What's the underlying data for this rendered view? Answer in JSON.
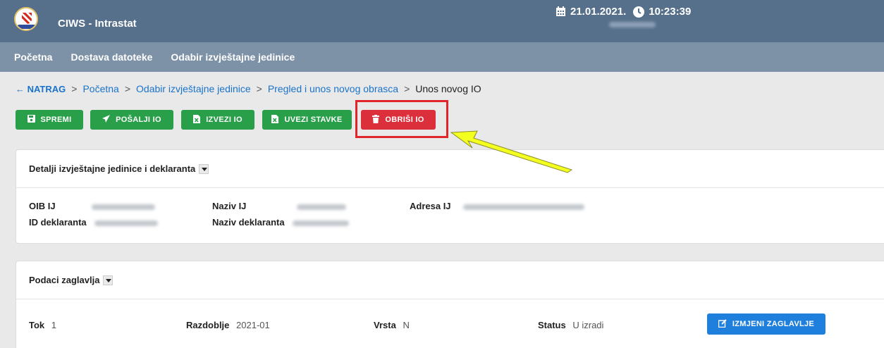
{
  "header": {
    "app_title": "CIWS - Intrastat",
    "date": "21.01.2021.",
    "time": "10:23:39"
  },
  "nav": {
    "items": [
      "Početna",
      "Dostava datoteke",
      "Odabir izvještajne jedinice"
    ]
  },
  "breadcrumb": {
    "back": "← NATRAG",
    "items": [
      "Početna",
      "Odabir izvještajne jedinice",
      "Pregled i unos novog obrasca"
    ],
    "current": "Unos novog IO",
    "separator": ">"
  },
  "toolbar": {
    "save": "SPREMI",
    "send": "POŠALJI IO",
    "export": "IZVEZI IO",
    "import": "UVEZI STAVKE",
    "delete": "OBRIŠI IO"
  },
  "details": {
    "title": "Detalji izvještajne jedinice i deklaranta",
    "oib_label": "OIB IJ",
    "naziv_label": "Naziv IJ",
    "adresa_label": "Adresa IJ",
    "id_label": "ID deklaranta",
    "naziv_dekl_label": "Naziv deklaranta"
  },
  "header_data": {
    "title": "Podaci zaglavlja",
    "tok_label": "Tok",
    "tok_value": "1",
    "razdoblje_label": "Razdoblje",
    "razdoblje_value": "2021-01",
    "vrsta_label": "Vrsta",
    "vrsta_value": "N",
    "status_label": "Status",
    "status_value": "U izradi",
    "edit_button": "IZMJENI ZAGLAVLJE"
  },
  "colors": {
    "topbar": "#566f8a",
    "navbar": "#7d91a7",
    "green": "#2a9f4a",
    "red": "#dc2f3c",
    "blue": "#1e7fdc",
    "highlight": "#e0262a",
    "arrow": "#f2ff1f"
  }
}
